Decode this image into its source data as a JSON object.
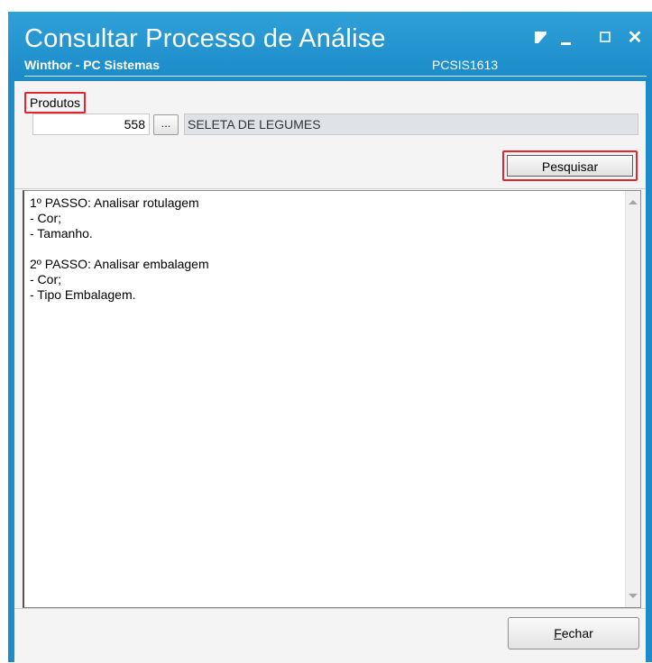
{
  "window": {
    "title": "Consultar Processo de Análise",
    "subtitle": "Winthor - PC Sistemas",
    "code": "PCSIS1613",
    "icons": [
      "restore-icon",
      "minimize-icon",
      "maximize-icon",
      "close-icon"
    ]
  },
  "produtos": {
    "label": "Produtos",
    "code_value": "558",
    "lookup_label": "...",
    "description": "SELETA DE LEGUMES"
  },
  "actions": {
    "search_label": "Pesquisar",
    "close_label_underlined": "F",
    "close_label_rest": "echar"
  },
  "memo": {
    "lines": [
      "1º PASSO: Analisar rotulagem",
      "- Cor;",
      "- Tamanho.",
      "",
      "2º PASSO: Analisar embalagem",
      "- Cor;",
      "- Tipo Embalagem."
    ]
  },
  "colors": {
    "titlebar": "#1b8bc9",
    "highlight": "#e8232b"
  }
}
